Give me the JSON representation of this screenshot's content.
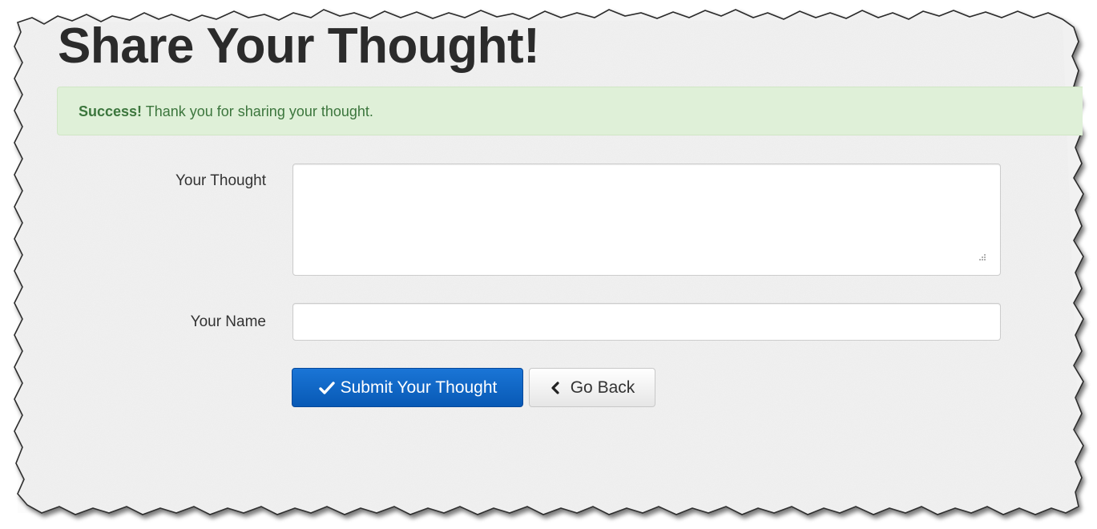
{
  "page": {
    "title": "Share Your Thought!"
  },
  "alert": {
    "strong": "Success!",
    "message": " Thank you for sharing your thought."
  },
  "form": {
    "thought_label": "Your Thought",
    "thought_value": "",
    "name_label": "Your Name",
    "name_value": ""
  },
  "buttons": {
    "submit_label": "Submit Your Thought",
    "submit_icon": "checkmark-icon",
    "back_label": "Go Back",
    "back_icon": "chevron-left-icon"
  },
  "colors": {
    "title": "#2b2b2b",
    "alert_background": "#dff0d8",
    "alert_text": "#3c763d",
    "primary_button": "#0d64c4",
    "paper": "#f1f1f1"
  }
}
